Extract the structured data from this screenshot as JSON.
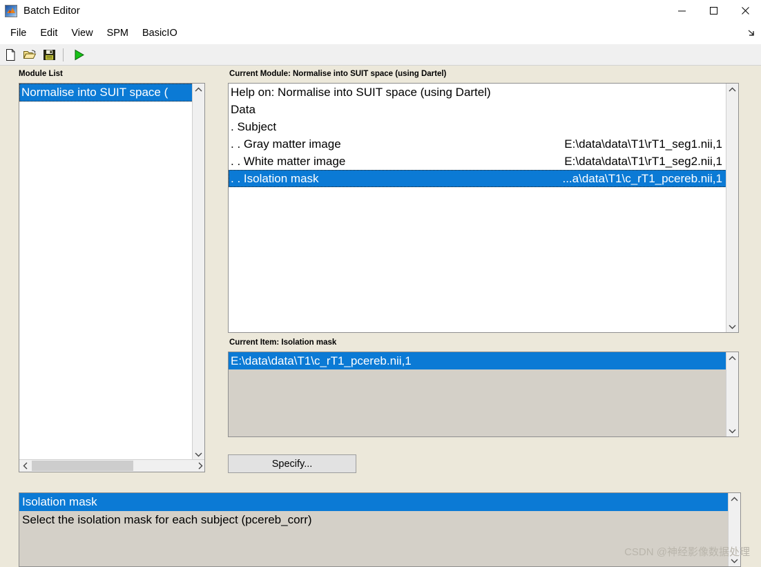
{
  "window": {
    "title": "Batch Editor",
    "icon": "matlab-logo-icon",
    "minimize_label": "─",
    "maximize_label": "□",
    "close_label": "✕"
  },
  "menu": {
    "items": [
      {
        "label": "File"
      },
      {
        "label": "Edit"
      },
      {
        "label": "View"
      },
      {
        "label": "SPM"
      },
      {
        "label": "BasicIO"
      }
    ],
    "corner_icon": "resize-arrow-icon"
  },
  "toolbar": {
    "buttons": [
      {
        "name": "new-file-icon",
        "label": "New"
      },
      {
        "name": "open-folder-icon",
        "label": "Open"
      },
      {
        "name": "save-icon",
        "label": "Save"
      },
      {
        "name": "run-icon",
        "label": "Run"
      }
    ]
  },
  "module_list": {
    "label": "Module List",
    "items": [
      {
        "label": "Normalise into SUIT space (",
        "selected": true
      }
    ]
  },
  "current_module": {
    "label": "Current Module: Normalise into SUIT space (using Dartel)",
    "rows": [
      {
        "label": "Help on: Normalise into SUIT space (using Dartel)",
        "value": "",
        "selected": false
      },
      {
        "label": "Data",
        "value": "",
        "selected": false
      },
      {
        "label": ". Subject",
        "value": "",
        "selected": false
      },
      {
        "label": ". . Gray matter image",
        "value": "E:\\data\\data\\T1\\rT1_seg1.nii,1",
        "selected": false
      },
      {
        "label": ". . White matter image",
        "value": "E:\\data\\data\\T1\\rT1_seg2.nii,1",
        "selected": false
      },
      {
        "label": ". . Isolation mask",
        "value": "...a\\data\\T1\\c_rT1_pcereb.nii,1",
        "selected": true
      }
    ]
  },
  "current_item": {
    "label": "Current Item: Isolation mask",
    "rows": [
      {
        "label": "E:\\data\\data\\T1\\c_rT1_pcereb.nii,1",
        "selected": true
      }
    ]
  },
  "specify": {
    "label": "Specify..."
  },
  "bottom_help": {
    "rows": [
      {
        "label": "Isolation mask",
        "selected": true
      },
      {
        "label": "Select the isolation mask for each subject (pcereb_corr)",
        "selected": false
      }
    ]
  },
  "watermark": {
    "text": "CSDN @神经影像数据处理"
  },
  "colors": {
    "background": "#ece8da",
    "selection": "#0b7ad5",
    "listbox_gray": "#d4d0c8",
    "titlebar": "#ffffff"
  }
}
